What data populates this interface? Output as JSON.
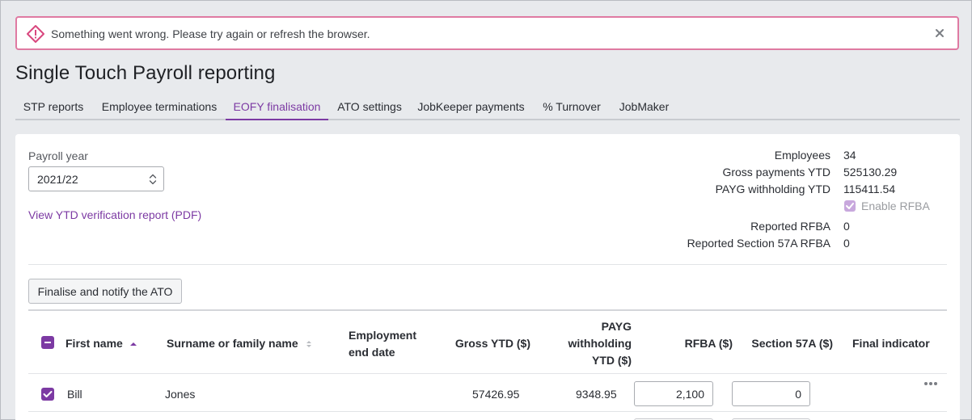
{
  "alert": {
    "message": "Something went wrong. Please try again or refresh the browser.",
    "icon": "warning-icon",
    "close_icon": "close-icon"
  },
  "page": {
    "title": "Single Touch Payroll reporting"
  },
  "tabs": [
    {
      "label": "STP reports",
      "active": false
    },
    {
      "label": "Employee terminations",
      "active": false
    },
    {
      "label": "EOFY finalisation",
      "active": true
    },
    {
      "label": "ATO settings",
      "active": false
    },
    {
      "label": "JobKeeper payments",
      "active": false
    },
    {
      "label": "% Turnover",
      "active": false
    },
    {
      "label": "JobMaker",
      "active": false
    }
  ],
  "form": {
    "payroll_year_label": "Payroll year",
    "payroll_year_value": "2021/22",
    "ytd_report_link": "View YTD verification report (PDF)",
    "finalise_button": "Finalise and notify the ATO"
  },
  "summary": {
    "employees_label": "Employees",
    "employees_value": "34",
    "gross_label": "Gross payments YTD",
    "gross_value": "525130.29",
    "payg_label": "PAYG withholding YTD",
    "payg_value": "115411.54",
    "enable_rfba_label": "Enable RFBA",
    "enable_rfba_checked": true,
    "reported_rfba_label": "Reported RFBA",
    "reported_rfba_value": "0",
    "reported_57a_label": "Reported Section 57A RFBA",
    "reported_57a_value": "0"
  },
  "table": {
    "headers": {
      "first_name": "First name",
      "surname": "Surname or family name",
      "employment_end_line1": "Employment",
      "employment_end_line2": "end date",
      "gross_ytd": "Gross YTD ($)",
      "payg_line1": "PAYG",
      "payg_line2": "withholding",
      "payg_line3": "YTD ($)",
      "rfba": "RFBA ($)",
      "section57a": "Section 57A ($)",
      "final_indicator": "Final indicator"
    },
    "rows": [
      {
        "checked": true,
        "first_name": "Bill",
        "surname": "Jones",
        "employment_end_date": "",
        "gross_ytd": "57426.95",
        "payg_ytd": "9348.95",
        "rfba": "2,100",
        "section57a": "0"
      }
    ]
  },
  "colors": {
    "accent": "#7c3aa3",
    "alert_border": "#df7aa2",
    "alert_icon": "#d9477e",
    "background": "#e8eaed"
  }
}
